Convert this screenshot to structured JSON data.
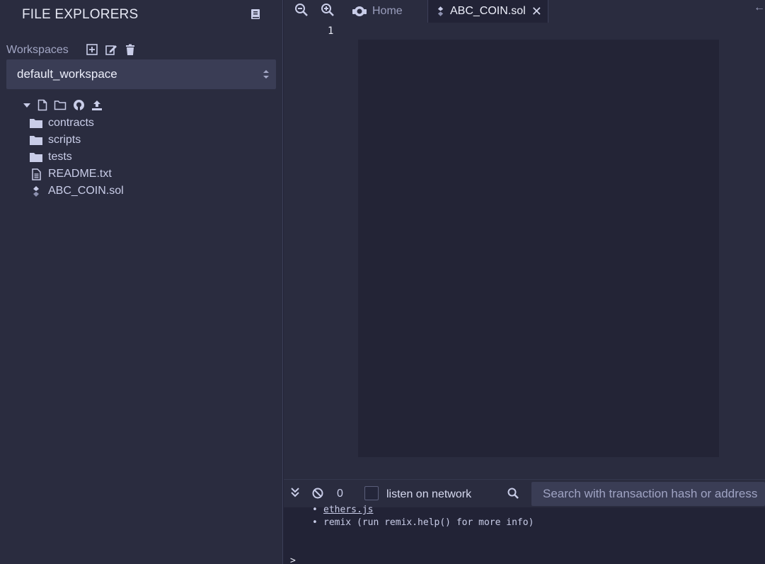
{
  "sidebar": {
    "title": "FILE EXPLORERS",
    "workspaces_label": "Workspaces",
    "workspace_selected": "default_workspace",
    "tree": [
      {
        "name": "contracts",
        "icon": "folder-icon"
      },
      {
        "name": "scripts",
        "icon": "folder-icon"
      },
      {
        "name": "tests",
        "icon": "folder-icon"
      },
      {
        "name": "README.txt",
        "icon": "file-text-icon"
      },
      {
        "name": "ABC_COIN.sol",
        "icon": "solidity-icon"
      }
    ]
  },
  "tabs": {
    "home_label": "Home",
    "active_label": "ABC_COIN.sol",
    "close_glyph": "✕"
  },
  "editor": {
    "line_number": "1"
  },
  "terminal": {
    "pending_count": "0",
    "listen_label": "listen on network",
    "search_placeholder": "Search with transaction hash or address",
    "lines": [
      {
        "bullet": "•",
        "link": "ethers.js",
        "text": ""
      },
      {
        "bullet": "•",
        "link": "",
        "text": "remix (run remix.help() for more info)"
      }
    ],
    "prompt": ">"
  },
  "colors": {
    "sidebar_bg": "#2a2c3f",
    "editor_bg": "#222336",
    "accent_text": "#c9cde8"
  }
}
